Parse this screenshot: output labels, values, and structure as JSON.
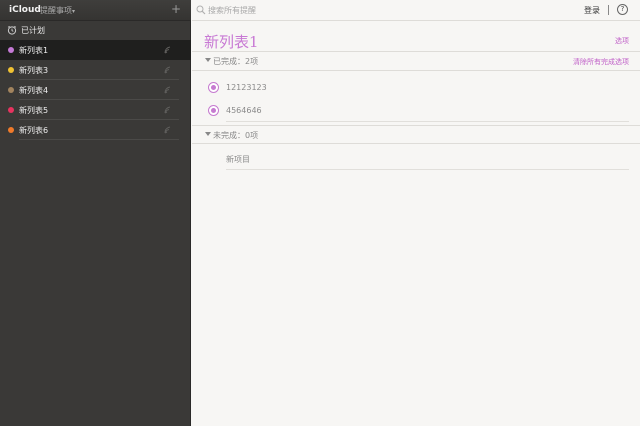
{
  "header": {
    "brand": "iCloud",
    "app_menu": "提醒事项",
    "add_label": "+"
  },
  "sidebar": {
    "scheduled": {
      "label": "已计划",
      "icon": "alarm-clock-icon"
    },
    "lists": [
      {
        "label": "新列表1",
        "color": "#c57ad6",
        "active": true
      },
      {
        "label": "新列表3",
        "color": "#f1c232",
        "active": false
      },
      {
        "label": "新列表4",
        "color": "#a2845e",
        "active": false
      },
      {
        "label": "新列表5",
        "color": "#e8335f",
        "active": false
      },
      {
        "label": "新列表6",
        "color": "#f07a2a",
        "active": false
      }
    ]
  },
  "topbar": {
    "search_placeholder": "搜索所有提醒",
    "login": "登录",
    "help": "?"
  },
  "main": {
    "title": "新列表1",
    "options": "选项",
    "completed": {
      "label": "已完成：2项",
      "clear": "清除所有完成选项",
      "items": [
        {
          "text": "12123123"
        },
        {
          "text": "4564646"
        }
      ]
    },
    "incomplete": {
      "label": "未完成：0项"
    },
    "new_item": "新项目"
  },
  "colors": {
    "accent": "#c879d4",
    "sidebar_bg": "#3a3937",
    "active_item_bg": "#1f1f1e"
  }
}
